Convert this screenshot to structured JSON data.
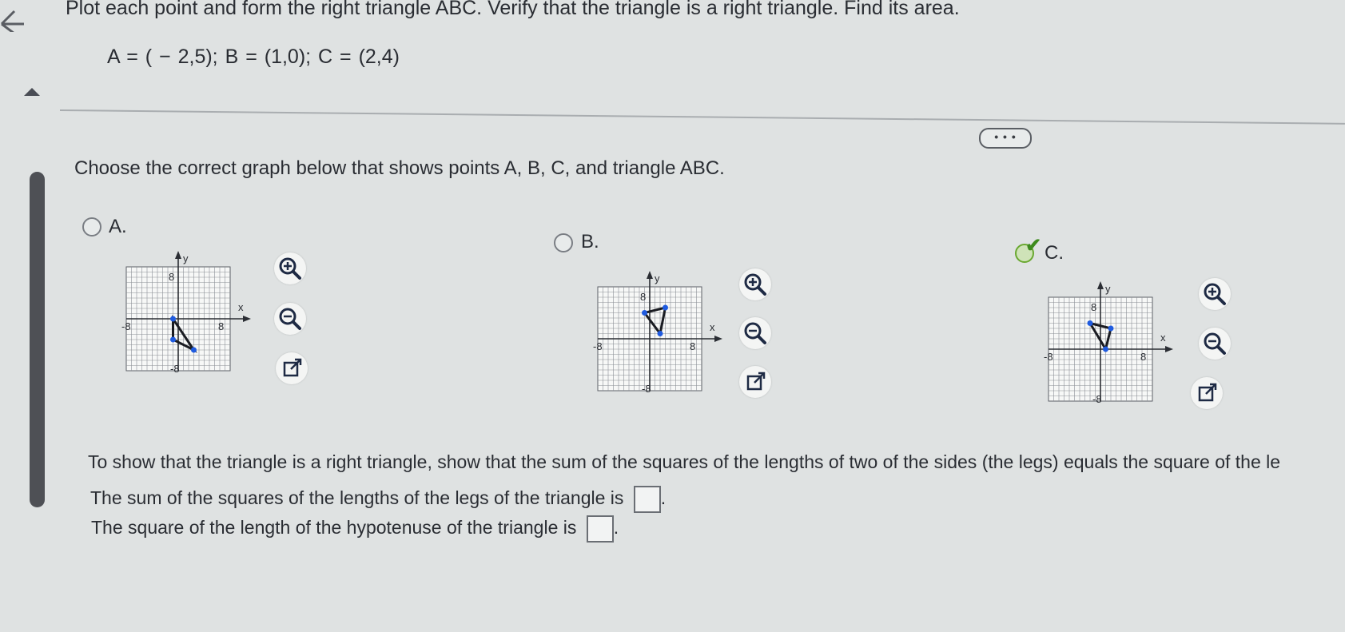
{
  "question": {
    "title": "Plot each point and form the right triangle ABC. Verify that the triangle is a right triangle. Find its area.",
    "points_text": "A = ( − 2,5);   B = (1,0);   C = (2,4)"
  },
  "more_button": "• • •",
  "instruction": "Choose the correct graph below that shows points A, B, C, and triangle ABC.",
  "options": [
    {
      "label": "A.",
      "selected": false,
      "axis_x": "x",
      "axis_y": "y",
      "tick_pos": "8",
      "tick_neg": "-8",
      "triangle": [
        [
          -1,
          0
        ],
        [
          -1,
          -4
        ],
        [
          3,
          -6
        ]
      ]
    },
    {
      "label": "B.",
      "selected": false,
      "axis_x": "x",
      "axis_y": "y",
      "tick_pos": "8",
      "tick_neg": "-8",
      "triangle": [
        [
          -1,
          5
        ],
        [
          2,
          1
        ],
        [
          3,
          6
        ]
      ]
    },
    {
      "label": "C.",
      "selected": true,
      "axis_x": "x",
      "axis_y": "y",
      "tick_pos": "8",
      "tick_neg": "-8",
      "triangle": [
        [
          -2,
          5
        ],
        [
          1,
          0
        ],
        [
          2,
          4
        ]
      ]
    }
  ],
  "tools": {
    "zoom_in": "zoom-in-icon",
    "zoom_out": "zoom-out-icon",
    "popout": "external-link-icon"
  },
  "explanation": "To show that the triangle is a right triangle, show that the sum of the squares of the lengths of two of the sides (the legs) equals the square of the le",
  "answer1": {
    "text": "The sum of the squares of the lengths of the legs of the triangle is",
    "value": ""
  },
  "answer2": {
    "text": "The square of the length of the hypotenuse of the triangle is",
    "value": ""
  },
  "colors": {
    "accent_green": "#3d8a1d",
    "point_blue": "#1f5be0"
  }
}
